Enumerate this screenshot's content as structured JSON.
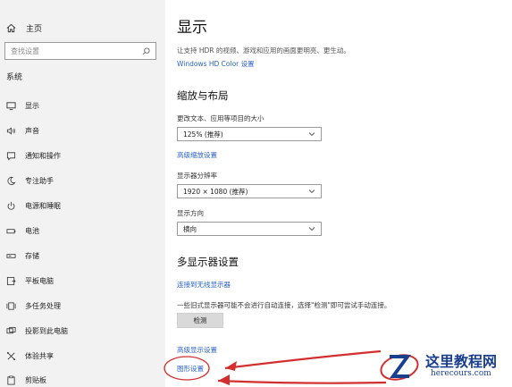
{
  "sidebar": {
    "home_label": "主页",
    "search_placeholder": "查找设置",
    "section_title": "系统",
    "items": [
      {
        "label": "显示",
        "icon": "monitor-icon"
      },
      {
        "label": "声音",
        "icon": "speaker-icon"
      },
      {
        "label": "通知和操作",
        "icon": "notification-icon"
      },
      {
        "label": "专注助手",
        "icon": "moon-icon"
      },
      {
        "label": "电源和睡眠",
        "icon": "power-icon"
      },
      {
        "label": "电池",
        "icon": "battery-icon"
      },
      {
        "label": "存储",
        "icon": "storage-icon"
      },
      {
        "label": "平板电脑",
        "icon": "tablet-icon"
      },
      {
        "label": "多任务处理",
        "icon": "multitask-icon"
      },
      {
        "label": "投影到此电脑",
        "icon": "project-icon"
      },
      {
        "label": "体验共享",
        "icon": "share-icon"
      },
      {
        "label": "剪贴板",
        "icon": "clipboard-icon"
      }
    ]
  },
  "main": {
    "title": "显示",
    "hdr_desc": "让支持 HDR 的视频、游戏和应用的画面更明亮、更生动。",
    "hdr_link": "Windows HD Color 设置",
    "scale_heading": "缩放与布局",
    "scale_label": "更改文本、应用等项目的大小",
    "scale_value": "125% (推荐)",
    "advanced_scale_link": "高级缩放设置",
    "resolution_label": "显示器分辨率",
    "resolution_value": "1920 × 1080 (推荐)",
    "orientation_label": "显示方向",
    "orientation_value": "横向",
    "multi_heading": "多显示器设置",
    "wireless_link": "连接到无线显示器",
    "detect_desc": "一些旧式显示器可能不会进行自动连接，选择\"检测\"即可尝试手动连接。",
    "detect_button": "检测",
    "advanced_display_link": "高级显示设置",
    "graphics_link": "图形设置"
  },
  "annotation": {
    "color": "#d32f2f"
  },
  "watermark": {
    "cn": "这里教程网",
    "en": "herecours.com"
  },
  "colors": {
    "link": "#2a62c9",
    "sidebar_bg": "#f2f2f2"
  }
}
